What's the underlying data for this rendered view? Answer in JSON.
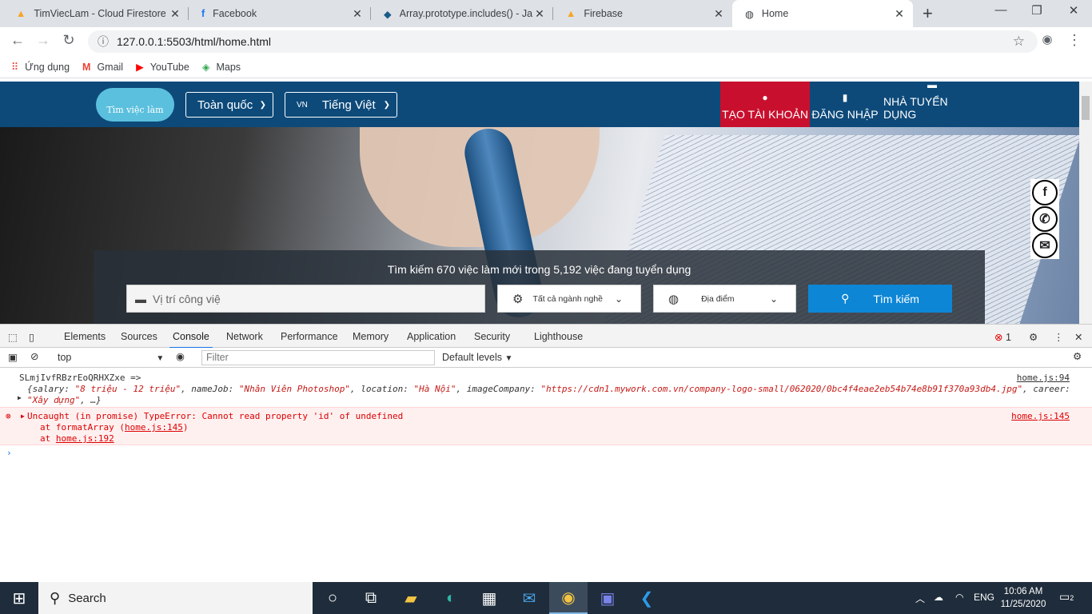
{
  "browser": {
    "tabs": [
      {
        "title": "TimViecLam - Cloud Firestore -",
        "icon": "firebase-icon"
      },
      {
        "title": "Facebook",
        "icon": "facebook-icon"
      },
      {
        "title": "Array.prototype.includes() - Jav",
        "icon": "mdn-icon"
      },
      {
        "title": "Firebase",
        "icon": "firebase-icon"
      },
      {
        "title": "Home",
        "icon": "globe-icon"
      }
    ],
    "url": "127.0.0.1:5503/html/home.html",
    "bookmarks": [
      "Ứng dụng",
      "Gmail",
      "YouTube",
      "Maps"
    ]
  },
  "site": {
    "logo_text": "Tìm việc làm",
    "region_select": "Toàn quốc",
    "lang_code": "VN",
    "lang_select": "Tiếng Việt",
    "nav": [
      "TẠO TÀI KHOẢN",
      "ĐĂNG NHẬP",
      "NHÀ TUYỂN DỤNG"
    ],
    "search_title": "Tìm kiếm 670 việc làm mới trong 5,192 việc đang tuyển dụng",
    "search_placeholder": "Vị trí công việ",
    "category_select": "Tất cả ngành nghề",
    "location_select": "Địa điểm",
    "search_button": "Tìm kiếm"
  },
  "devtools": {
    "tabs": [
      "Elements",
      "Sources",
      "Console",
      "Network",
      "Performance",
      "Memory",
      "Application",
      "Security",
      "Lighthouse"
    ],
    "active_tab": "Console",
    "error_count": "1",
    "context": "top",
    "filter_placeholder": "Filter",
    "levels": "Default levels",
    "log1": "SLmjIvfRBzrEoQRHXZxe  =>",
    "log1_source": "home.js:94",
    "log1_obj_a": "{salary: ",
    "log1_obj_salary": "\"8 triệu - 12 triệu\"",
    "log1_obj_b": ", nameJob: ",
    "log1_obj_name": "\"Nhân Viên Photoshop\"",
    "log1_obj_c": ", location: ",
    "log1_obj_loc": "\"Hà Nội\"",
    "log1_obj_d": ", imageCompany: ",
    "log1_obj_img": "\"https://cdn1.mywork.com.vn/company-logo-small/062020/0bc4f4eae2eb54b74e8b91f370a93db4.jpg\"",
    "log1_obj_e": ", career:",
    "log1_obj_career": "\"Xây dựng\"",
    "log1_obj_f": ", …}",
    "error_text": "Uncaught (in promise) TypeError: Cannot read property 'id' of undefined",
    "error_source": "home.js:145",
    "stack1_a": "at formatArray (",
    "stack1_link": "home.js:145",
    "stack1_b": ")",
    "stack2_a": "at ",
    "stack2_link": "home.js:192"
  },
  "taskbar": {
    "search": "Search",
    "lang": "ENG",
    "time": "10:06 AM",
    "date": "11/25/2020",
    "notif_count": "2"
  }
}
